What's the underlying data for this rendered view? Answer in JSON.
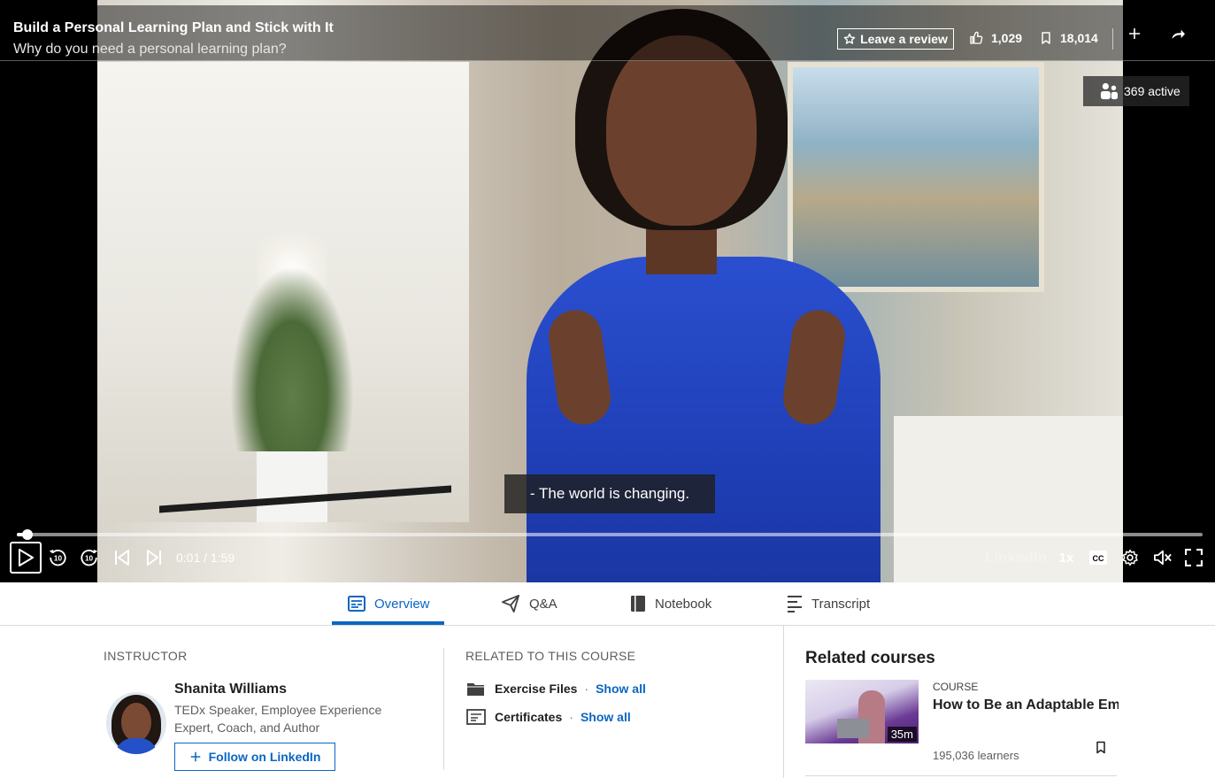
{
  "player": {
    "course_title": "Build a Personal Learning Plan and Stick with It",
    "video_title": "Why do you need a personal learning plan?",
    "review_label": "Leave a review",
    "likes": "1,029",
    "saves": "18,014",
    "active_count": "369 active",
    "caption": "- The world is changing.",
    "progress_fraction": 0.008,
    "time": "0:01 / 1:59",
    "watermark": "LinkedIn",
    "speed": "1x",
    "cc_label": "CC",
    "skip_seconds": "10",
    "icons": [
      "star-icon",
      "like-icon",
      "bookmark-icon",
      "plus-icon",
      "share-icon",
      "learners-icon",
      "play-icon",
      "rewind-10-icon",
      "forward-10-icon",
      "previous-icon",
      "next-icon",
      "closed-captions-icon",
      "settings-icon",
      "mute-icon",
      "fullscreen-icon"
    ]
  },
  "tabs": [
    {
      "label": "Overview",
      "icon": "overview-icon"
    },
    {
      "label": "Q&A",
      "icon": "paper-plane-icon"
    },
    {
      "label": "Notebook",
      "icon": "notebook-icon"
    },
    {
      "label": "Transcript",
      "icon": "transcript-icon"
    }
  ],
  "instructor": {
    "section_label": "INSTRUCTOR",
    "name": "Shanita Williams",
    "bio": "TEDx Speaker, Employee Experience Expert, Coach, and Author",
    "follow_label": "Follow on LinkedIn"
  },
  "related_to_course": {
    "section_label": "RELATED TO THIS COURSE",
    "items": [
      {
        "label": "Exercise Files",
        "action": "Show all",
        "icon": "folder-icon"
      },
      {
        "label": "Certificates",
        "action": "Show all",
        "icon": "certificate-icon"
      }
    ]
  },
  "related_courses": {
    "title": "Related courses",
    "items": [
      {
        "type": "COURSE",
        "name": "How to Be an Adaptable Employee during Change...",
        "duration": "35m",
        "learners": "195,036 learners"
      }
    ]
  },
  "colors": {
    "accent": "#0a66c2",
    "player_bg": "#000000",
    "text_primary": "#1f1f1f",
    "text_secondary": "#5e5e5e"
  }
}
